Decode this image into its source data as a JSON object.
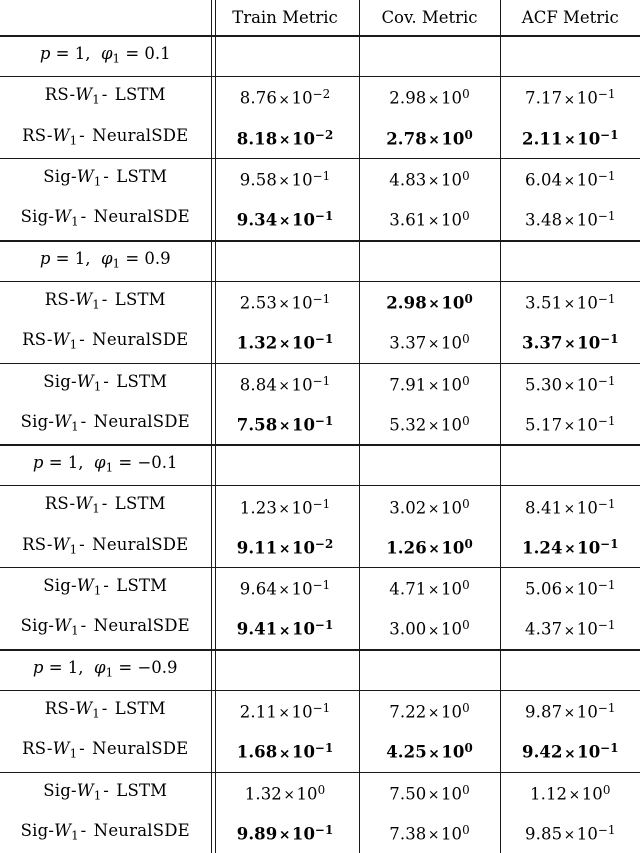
{
  "table": {
    "columns": [
      {
        "key": "label",
        "header": ""
      },
      {
        "key": "train",
        "header": "Train Metric"
      },
      {
        "key": "cov",
        "header": "Cov. Metric"
      },
      {
        "key": "acf",
        "header": "ACF Metric"
      }
    ],
    "row_label_parts": {
      "rs_lstm": {
        "prefix": "RS-",
        "var": "W",
        "sub": "1",
        "sep": " - ",
        "model": "LSTM"
      },
      "rs_nsde": {
        "prefix": "RS-",
        "var": "W",
        "sub": "1",
        "sep": " - ",
        "model": "NeuralSDE"
      },
      "sig_lstm": {
        "prefix": "Sig-",
        "var": "W",
        "sub": "1",
        "sep": " - ",
        "model": "LSTM"
      },
      "sig_nsde": {
        "prefix": "Sig-",
        "var": "W",
        "sub": "1",
        "sep": " - ",
        "model": "NeuralSDE"
      }
    },
    "groups": [
      {
        "header": {
          "p_label": "p",
          "p_eq": "= 1,",
          "phi_var": "φ",
          "phi_sub": "1",
          "phi_eq": "= 0.1",
          "text": "p = 1,  φ₁ = 0.1"
        },
        "blocks": [
          {
            "rows": [
              {
                "label_key": "rs_lstm",
                "cells": [
                  {
                    "mant": "8.76",
                    "exp": "−2",
                    "bold": false
                  },
                  {
                    "mant": "2.98",
                    "exp": "0",
                    "bold": false
                  },
                  {
                    "mant": "7.17",
                    "exp": "−1",
                    "bold": false
                  }
                ]
              },
              {
                "label_key": "rs_nsde",
                "cells": [
                  {
                    "mant": "8.18",
                    "exp": "−2",
                    "bold": true
                  },
                  {
                    "mant": "2.78",
                    "exp": "0",
                    "bold": true
                  },
                  {
                    "mant": "2.11",
                    "exp": "−1",
                    "bold": true
                  }
                ]
              }
            ]
          },
          {
            "rows": [
              {
                "label_key": "sig_lstm",
                "cells": [
                  {
                    "mant": "9.58",
                    "exp": "−1",
                    "bold": false
                  },
                  {
                    "mant": "4.83",
                    "exp": "0",
                    "bold": false
                  },
                  {
                    "mant": "6.04",
                    "exp": "−1",
                    "bold": false
                  }
                ]
              },
              {
                "label_key": "sig_nsde",
                "cells": [
                  {
                    "mant": "9.34",
                    "exp": "−1",
                    "bold": true
                  },
                  {
                    "mant": "3.61",
                    "exp": "0",
                    "bold": false
                  },
                  {
                    "mant": "3.48",
                    "exp": "−1",
                    "bold": false
                  }
                ]
              }
            ]
          }
        ]
      },
      {
        "header": {
          "p_label": "p",
          "p_eq": "= 1,",
          "phi_var": "φ",
          "phi_sub": "1",
          "phi_eq": "= 0.9",
          "text": "p = 1,  φ₁ = 0.9"
        },
        "blocks": [
          {
            "rows": [
              {
                "label_key": "rs_lstm",
                "cells": [
                  {
                    "mant": "2.53",
                    "exp": "−1",
                    "bold": false
                  },
                  {
                    "mant": "2.98",
                    "exp": "0",
                    "bold": true
                  },
                  {
                    "mant": "3.51",
                    "exp": "−1",
                    "bold": false
                  }
                ]
              },
              {
                "label_key": "rs_nsde",
                "cells": [
                  {
                    "mant": "1.32",
                    "exp": "−1",
                    "bold": true
                  },
                  {
                    "mant": "3.37",
                    "exp": "0",
                    "bold": false
                  },
                  {
                    "mant": "3.37",
                    "exp": "−1",
                    "bold": true
                  }
                ]
              }
            ]
          },
          {
            "rows": [
              {
                "label_key": "sig_lstm",
                "cells": [
                  {
                    "mant": "8.84",
                    "exp": "−1",
                    "bold": false
                  },
                  {
                    "mant": "7.91",
                    "exp": "0",
                    "bold": false
                  },
                  {
                    "mant": "5.30",
                    "exp": "−1",
                    "bold": false
                  }
                ]
              },
              {
                "label_key": "sig_nsde",
                "cells": [
                  {
                    "mant": "7.58",
                    "exp": "−1",
                    "bold": true
                  },
                  {
                    "mant": "5.32",
                    "exp": "0",
                    "bold": false
                  },
                  {
                    "mant": "5.17",
                    "exp": "−1",
                    "bold": false
                  }
                ]
              }
            ]
          }
        ]
      },
      {
        "header": {
          "p_label": "p",
          "p_eq": "= 1,",
          "phi_var": "φ",
          "phi_sub": "1",
          "phi_eq": "= −0.1",
          "text": "p = 1,  φ₁ = −0.1"
        },
        "blocks": [
          {
            "rows": [
              {
                "label_key": "rs_lstm",
                "cells": [
                  {
                    "mant": "1.23",
                    "exp": "−1",
                    "bold": false
                  },
                  {
                    "mant": "3.02",
                    "exp": "0",
                    "bold": false
                  },
                  {
                    "mant": "8.41",
                    "exp": "−1",
                    "bold": false
                  }
                ]
              },
              {
                "label_key": "rs_nsde",
                "cells": [
                  {
                    "mant": "9.11",
                    "exp": "−2",
                    "bold": true
                  },
                  {
                    "mant": "1.26",
                    "exp": "0",
                    "bold": true
                  },
                  {
                    "mant": "1.24",
                    "exp": "−1",
                    "bold": true
                  }
                ]
              }
            ]
          },
          {
            "rows": [
              {
                "label_key": "sig_lstm",
                "cells": [
                  {
                    "mant": "9.64",
                    "exp": "−1",
                    "bold": false
                  },
                  {
                    "mant": "4.71",
                    "exp": "0",
                    "bold": false
                  },
                  {
                    "mant": "5.06",
                    "exp": "−1",
                    "bold": false
                  }
                ]
              },
              {
                "label_key": "sig_nsde",
                "cells": [
                  {
                    "mant": "9.41",
                    "exp": "−1",
                    "bold": true
                  },
                  {
                    "mant": "3.00",
                    "exp": "0",
                    "bold": false
                  },
                  {
                    "mant": "4.37",
                    "exp": "−1",
                    "bold": false
                  }
                ]
              }
            ]
          }
        ]
      },
      {
        "header": {
          "p_label": "p",
          "p_eq": "= 1,",
          "phi_var": "φ",
          "phi_sub": "1",
          "phi_eq": "= −0.9",
          "text": "p = 1,  φ₁ = −0.9"
        },
        "blocks": [
          {
            "rows": [
              {
                "label_key": "rs_lstm",
                "cells": [
                  {
                    "mant": "2.11",
                    "exp": "−1",
                    "bold": false
                  },
                  {
                    "mant": "7.22",
                    "exp": "0",
                    "bold": false
                  },
                  {
                    "mant": "9.87",
                    "exp": "−1",
                    "bold": false
                  }
                ]
              },
              {
                "label_key": "rs_nsde",
                "cells": [
                  {
                    "mant": "1.68",
                    "exp": "−1",
                    "bold": true
                  },
                  {
                    "mant": "4.25",
                    "exp": "0",
                    "bold": true
                  },
                  {
                    "mant": "9.42",
                    "exp": "−1",
                    "bold": true
                  }
                ]
              }
            ]
          },
          {
            "rows": [
              {
                "label_key": "sig_lstm",
                "cells": [
                  {
                    "mant": "1.32",
                    "exp": "0",
                    "bold": false
                  },
                  {
                    "mant": "7.50",
                    "exp": "0",
                    "bold": false
                  },
                  {
                    "mant": "1.12",
                    "exp": "0",
                    "bold": false
                  }
                ]
              },
              {
                "label_key": "sig_nsde",
                "cells": [
                  {
                    "mant": "9.89",
                    "exp": "−1",
                    "bold": true
                  },
                  {
                    "mant": "7.38",
                    "exp": "0",
                    "bold": false
                  },
                  {
                    "mant": "9.85",
                    "exp": "−1",
                    "bold": false
                  }
                ]
              }
            ]
          }
        ]
      }
    ],
    "symbols": {
      "times": "×",
      "base": "10"
    },
    "colors": {
      "rule": "#1a1a1a",
      "text": "#000000",
      "background": "#ffffff"
    }
  }
}
